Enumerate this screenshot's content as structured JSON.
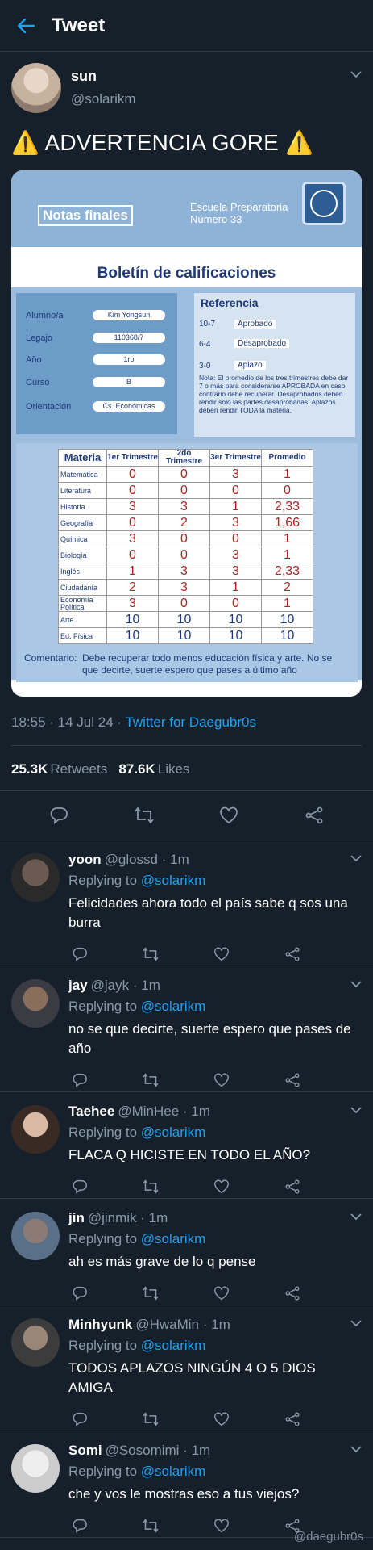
{
  "header": {
    "back_icon": "back-arrow-icon",
    "title": "Tweet"
  },
  "tweet": {
    "name": "sun",
    "handle": "@solarikm",
    "text": "⚠️ ADVERTENCIA GORE ⚠️",
    "time": "18:55 · 14 Jul 24 · ",
    "client": "Twitter for Daegubr0s",
    "retweets": "25.3K",
    "retweets_label": "Retweets",
    "likes": "87.6K",
    "likes_label": "Likes"
  },
  "report": {
    "notas": "Notas finales",
    "school1": "Escuela Preparatoria",
    "school2": "Número 33",
    "title": "Boletín de calificaciones",
    "fields": [
      {
        "k": "Alumno/a",
        "v": "Kim Yongsun"
      },
      {
        "k": "Legajo",
        "v": "110368/7"
      },
      {
        "k": "Año",
        "v": "1ro"
      },
      {
        "k": "Curso",
        "v": "B"
      },
      {
        "k": "Orientación",
        "v": "Cs. Económicas"
      }
    ],
    "ref_title": "Referencia",
    "refs": [
      {
        "r": "10-7",
        "l": "Aprobado"
      },
      {
        "r": "6-4",
        "l": "Desaprobado"
      },
      {
        "r": "3-0",
        "l": "Aplazo"
      }
    ],
    "ref_note": "Nota: El promedio de los tres trimestres debe dar 7 o más para considerarse APROBADA en caso contrario debe recuperar. Desaprobados deben rendir sólo las partes desaprobadas. Aplazos deben rendir TODA la materia.",
    "headers": [
      "Materia",
      "1er Trimestre",
      "2do Trimestre",
      "3er Trimestre",
      "Promedio"
    ],
    "rows": [
      [
        "Matemática",
        "0",
        "0",
        "3",
        "1"
      ],
      [
        "Literatura",
        "0",
        "0",
        "0",
        "0"
      ],
      [
        "Historia",
        "3",
        "3",
        "1",
        "2,33"
      ],
      [
        "Geografía",
        "0",
        "2",
        "3",
        "1,66"
      ],
      [
        "Química",
        "3",
        "0",
        "0",
        "1"
      ],
      [
        "Biología",
        "0",
        "0",
        "3",
        "1"
      ],
      [
        "Inglés",
        "1",
        "3",
        "3",
        "2,33"
      ],
      [
        "Ciudadanía",
        "2",
        "3",
        "1",
        "2"
      ],
      [
        "Economía Política",
        "3",
        "0",
        "0",
        "1"
      ],
      [
        "Arte",
        "10",
        "10",
        "10",
        "10"
      ],
      [
        "Ed. Física",
        "10",
        "10",
        "10",
        "10"
      ]
    ],
    "comment_label": "Comentario:",
    "comment": "Debe recuperar todo menos educación física y arte. No se que decirte, suerte espero que pases a último año"
  },
  "replies": [
    {
      "name": "yoon",
      "handle": "@glossd",
      "time": "· 1m",
      "to": "@solarikm",
      "text": "Felicidades ahora todo el país sabe q sos una burra"
    },
    {
      "name": "jay",
      "handle": "@jayk",
      "time": "· 1m",
      "to": "@solarikm",
      "text": "no se que decirte, suerte espero que pases de año"
    },
    {
      "name": "Taehee",
      "handle": "@MinHee",
      "time": "· 1m",
      "to": "@solarikm",
      "text": "FLACA Q HICISTE EN TODO EL AÑO?"
    },
    {
      "name": "jin",
      "handle": "@jinmik",
      "time": "· 1m",
      "to": "@solarikm",
      "text": "ah es más grave de lo q pense"
    },
    {
      "name": "Minhyunk",
      "handle": "@HwaMin",
      "time": "· 1m",
      "to": "@solarikm",
      "text": "TODOS APLAZOS NINGÚN 4 O 5 DIOS AMIGA"
    },
    {
      "name": "Somi",
      "handle": "@Sosomimi",
      "time": "· 1m",
      "to": "@solarikm",
      "text": "che y vos le mostras eso a tus viejos?"
    }
  ],
  "replying_to": "Replying to ",
  "watermark": "@daegubr0s"
}
